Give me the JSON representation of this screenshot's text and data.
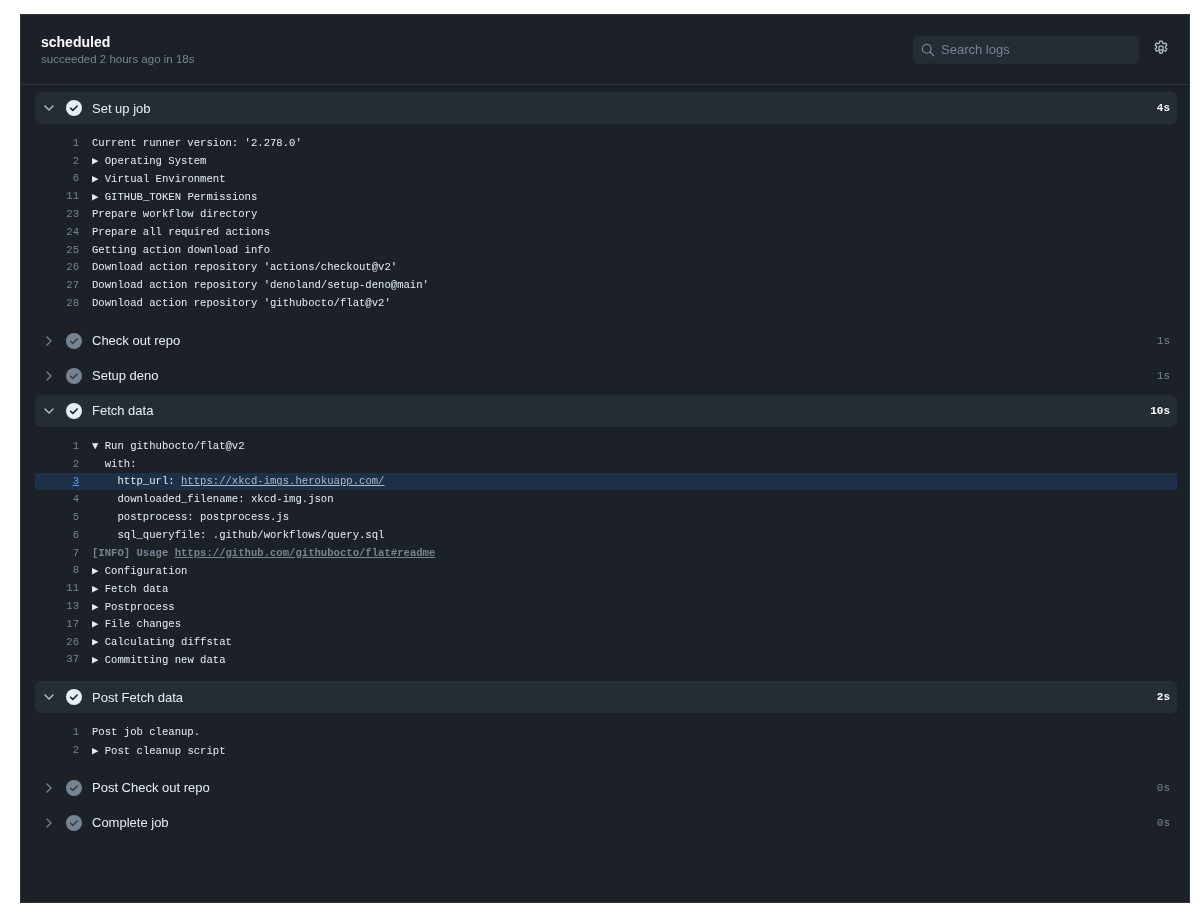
{
  "header": {
    "title": "scheduled",
    "subtitle": "succeeded 2 hours ago in 18s",
    "search": {
      "placeholder": "Search logs"
    }
  },
  "steps": [
    {
      "name": "Set up job",
      "duration": "4s",
      "expanded": true,
      "lines": [
        {
          "number": "1",
          "text": "Current runner version: '2.278.0'",
          "kind": "plain",
          "selected": false
        },
        {
          "number": "2",
          "marker": "▶",
          "text": "Operating System",
          "kind": "plain",
          "selected": false
        },
        {
          "number": "6",
          "marker": "▶",
          "text": "Virtual Environment",
          "kind": "plain",
          "selected": false
        },
        {
          "number": "11",
          "marker": "▶",
          "text": "GITHUB_TOKEN Permissions",
          "kind": "plain",
          "selected": false
        },
        {
          "number": "23",
          "text": "Prepare workflow directory",
          "kind": "plain",
          "selected": false
        },
        {
          "number": "24",
          "text": "Prepare all required actions",
          "kind": "plain",
          "selected": false
        },
        {
          "number": "25",
          "text": "Getting action download info",
          "kind": "plain",
          "selected": false
        },
        {
          "number": "26",
          "text": "Download action repository 'actions/checkout@v2'",
          "kind": "plain",
          "selected": false
        },
        {
          "number": "27",
          "text": "Download action repository 'denoland/setup-deno@main'",
          "kind": "plain",
          "selected": false
        },
        {
          "number": "28",
          "text": "Download action repository 'githubocto/flat@v2'",
          "kind": "plain",
          "selected": false
        }
      ]
    },
    {
      "name": "Check out repo",
      "duration": "1s",
      "expanded": false
    },
    {
      "name": "Setup deno",
      "duration": "1s",
      "expanded": false
    },
    {
      "name": "Fetch data",
      "duration": "10s",
      "expanded": true,
      "lines": [
        {
          "number": "1",
          "marker": "▼",
          "text": "Run githubocto/flat@v2",
          "kind": "plain",
          "selected": false
        },
        {
          "number": "2",
          "text": "  with:",
          "kind": "plain",
          "selected": false
        },
        {
          "number": "3",
          "text": "    http_url: ",
          "link": "https://xkcd-imgs.herokuapp.com/",
          "kind": "plain",
          "selected": true
        },
        {
          "number": "4",
          "text": "    downloaded_filename: xkcd-img.json",
          "kind": "plain",
          "selected": false
        },
        {
          "number": "5",
          "text": "    postprocess: postprocess.js",
          "kind": "plain",
          "selected": false
        },
        {
          "number": "6",
          "text": "    sql_queryfile: .github/workflows/query.sql",
          "kind": "plain",
          "selected": false
        },
        {
          "number": "7",
          "text": "[INFO] Usage ",
          "link": "https://github.com/githubocto/flat#readme",
          "kind": "info",
          "selected": false
        },
        {
          "number": "8",
          "marker": "▶",
          "text": "Configuration",
          "kind": "plain",
          "selected": false
        },
        {
          "number": "11",
          "marker": "▶",
          "text": "Fetch data",
          "kind": "plain",
          "selected": false
        },
        {
          "number": "13",
          "marker": "▶",
          "text": "Postprocess",
          "kind": "plain",
          "selected": false
        },
        {
          "number": "17",
          "marker": "▶",
          "text": "File changes",
          "kind": "plain",
          "selected": false
        },
        {
          "number": "26",
          "marker": "▶",
          "text": "Calculating diffstat",
          "kind": "plain",
          "selected": false
        },
        {
          "number": "37",
          "marker": "▶",
          "text": "Committing new data",
          "kind": "plain",
          "selected": false
        }
      ]
    },
    {
      "name": "Post Fetch data",
      "duration": "2s",
      "expanded": true,
      "lines": [
        {
          "number": "1",
          "text": "Post job cleanup.",
          "kind": "plain",
          "selected": false
        },
        {
          "number": "2",
          "marker": "▶",
          "text": "Post cleanup script",
          "kind": "plain",
          "selected": false
        }
      ]
    },
    {
      "name": "Post Check out repo",
      "duration": "0s",
      "expanded": false
    },
    {
      "name": "Complete job",
      "duration": "0s",
      "expanded": false
    }
  ]
}
